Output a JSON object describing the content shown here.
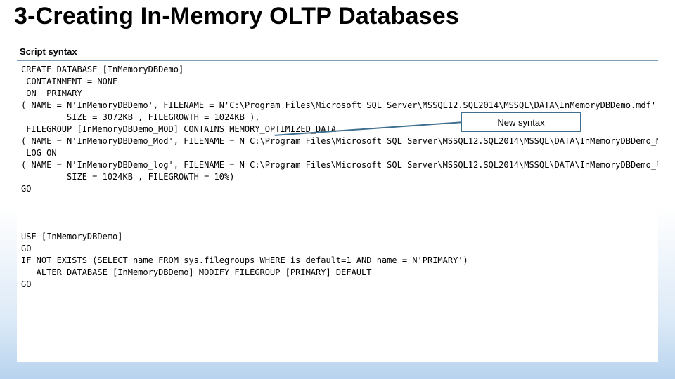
{
  "title": "3-Creating In-Memory OLTP Databases",
  "subtitle": "Script syntax",
  "callout": "New syntax",
  "code": "CREATE DATABASE [InMemoryDBDemo]\n CONTAINMENT = NONE\n ON  PRIMARY\n( NAME = N'InMemoryDBDemo', FILENAME = N'C:\\Program Files\\Microsoft SQL Server\\MSSQL12.SQL2014\\MSSQL\\DATA\\InMemoryDBDemo.mdf' ,\n         SIZE = 3072KB , FILEGROWTH = 1024KB ),\n FILEGROUP [InMemoryDBDemo_MOD] CONTAINS MEMORY_OPTIMIZED_DATA\n( NAME = N'InMemoryDBDemo_Mod', FILENAME = N'C:\\Program Files\\Microsoft SQL Server\\MSSQL12.SQL2014\\MSSQL\\DATA\\InMemoryDBDemo_Mod' )\n LOG ON\n( NAME = N'InMemoryDBDemo_log', FILENAME = N'C:\\Program Files\\Microsoft SQL Server\\MSSQL12.SQL2014\\MSSQL\\DATA\\InMemoryDBDemo_log.ldf' ,\n         SIZE = 1024KB , FILEGROWTH = 10%)\nGO\n\n\n\nUSE [InMemoryDBDemo]\nGO\nIF NOT EXISTS (SELECT name FROM sys.filegroups WHERE is_default=1 AND name = N'PRIMARY')\n   ALTER DATABASE [InMemoryDBDemo] MODIFY FILEGROUP [PRIMARY] DEFAULT\nGO"
}
